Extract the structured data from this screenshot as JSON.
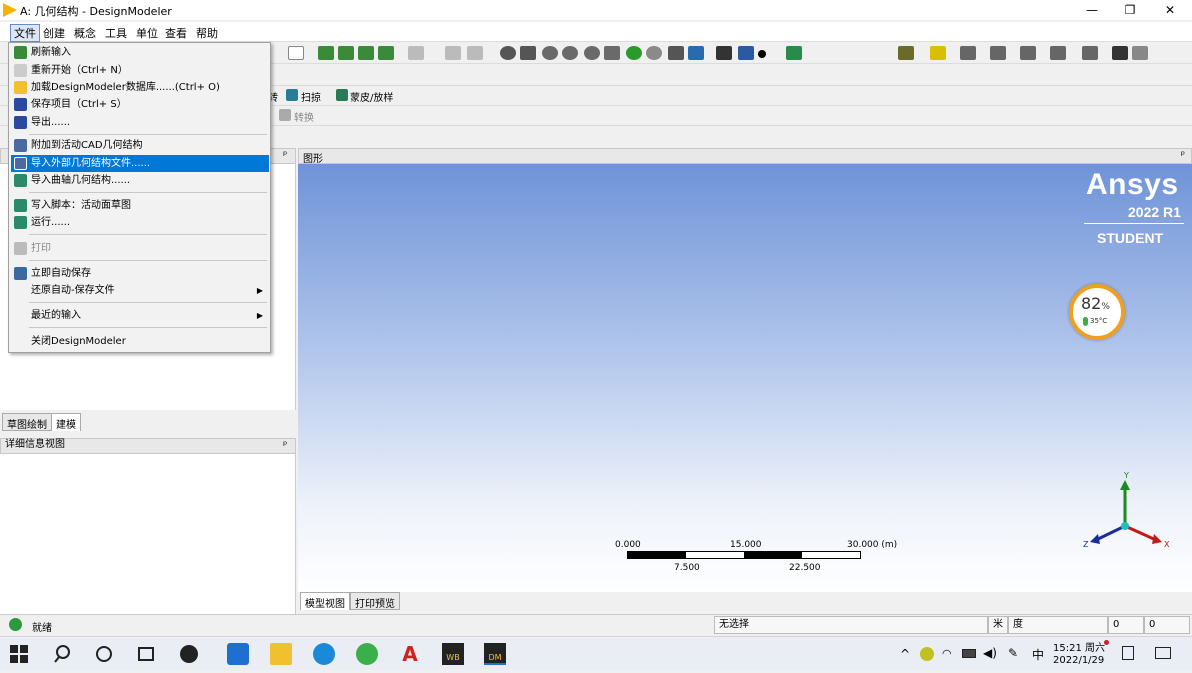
{
  "window": {
    "title": "A: 几何结构 - DesignModeler",
    "minimize": "—",
    "restore": "❐",
    "close": "✕"
  },
  "menubar": [
    "文件",
    "创建",
    "概念",
    "工具",
    "单位",
    "查看",
    "帮助"
  ],
  "toolbar_row2": {
    "sweep_label": "扫掠",
    "skin_loft_label": "蒙皮/放样",
    "partial_label": "转"
  },
  "toolbar_row3": {
    "convert_label": "转换"
  },
  "file_menu": {
    "items": [
      {
        "label": "刷新输入",
        "icon": "refresh-icon",
        "disabled": false
      },
      {
        "label": "重新开始（Ctrl+ N）",
        "icon": "new-icon",
        "disabled": false
      },
      {
        "label": "加载DesignModeler数据库......(Ctrl+ O)",
        "icon": "open-folder-icon",
        "disabled": false
      },
      {
        "label": "保存项目（Ctrl+ S）",
        "icon": "save-icon",
        "disabled": false
      },
      {
        "label": "导出......",
        "icon": "export-icon",
        "disabled": false
      },
      {
        "label": "附加到活动CAD几何结构",
        "icon": "attach-cad-icon",
        "disabled": false
      },
      {
        "label": "导入外部几何结构文件......",
        "icon": "import-geometry-icon",
        "disabled": false,
        "highlighted": true
      },
      {
        "label": "导入曲轴几何结构......",
        "icon": "crankshaft-icon",
        "disabled": false
      },
      {
        "label": "写入脚本：活动面草图",
        "icon": "script-icon",
        "disabled": false
      },
      {
        "label": "运行......",
        "icon": "run-icon",
        "disabled": false
      },
      {
        "label": "打印",
        "icon": "print-icon",
        "disabled": true
      },
      {
        "label": "立即自动保存",
        "icon": "autosave-icon",
        "disabled": false
      },
      {
        "label": "还原自动-保存文件",
        "icon": "",
        "disabled": false,
        "submenu": true
      },
      {
        "label": "最近的输入",
        "icon": "",
        "disabled": false,
        "submenu": true
      },
      {
        "label": "关闭DesignModeler",
        "icon": "",
        "disabled": false
      }
    ]
  },
  "panels": {
    "tree_pin": "ᵖ",
    "tabs": [
      "草图绘制",
      "建模"
    ],
    "details_title": "详细信息视图",
    "graphics_title": "图形",
    "bottom_tabs": [
      "模型视图",
      "打印预览"
    ]
  },
  "branding": {
    "name": "Ansys",
    "version": "2022 R1",
    "edition": "STUDENT"
  },
  "widget": {
    "percent": "82",
    "percent_unit": "%",
    "temp": "35°C"
  },
  "scale_bar": {
    "top_labels": [
      "0.000",
      "15.000",
      "30.000 (m)"
    ],
    "bottom_labels": [
      "7.500",
      "22.500"
    ]
  },
  "triad": {
    "x": "X",
    "y": "Y",
    "z": "Z"
  },
  "status": {
    "ready": "就绪",
    "selection": "无选择",
    "unit1": "米",
    "unit2": "度",
    "v1": "0",
    "v2": "0"
  },
  "taskbar": {
    "time": "15:21 周六",
    "date": "2022/1/29",
    "ime": "中",
    "apps": [
      "WB",
      "DM"
    ]
  },
  "colors": {
    "highlight": "#0078d7",
    "ansys_accent": "#f5b400"
  }
}
